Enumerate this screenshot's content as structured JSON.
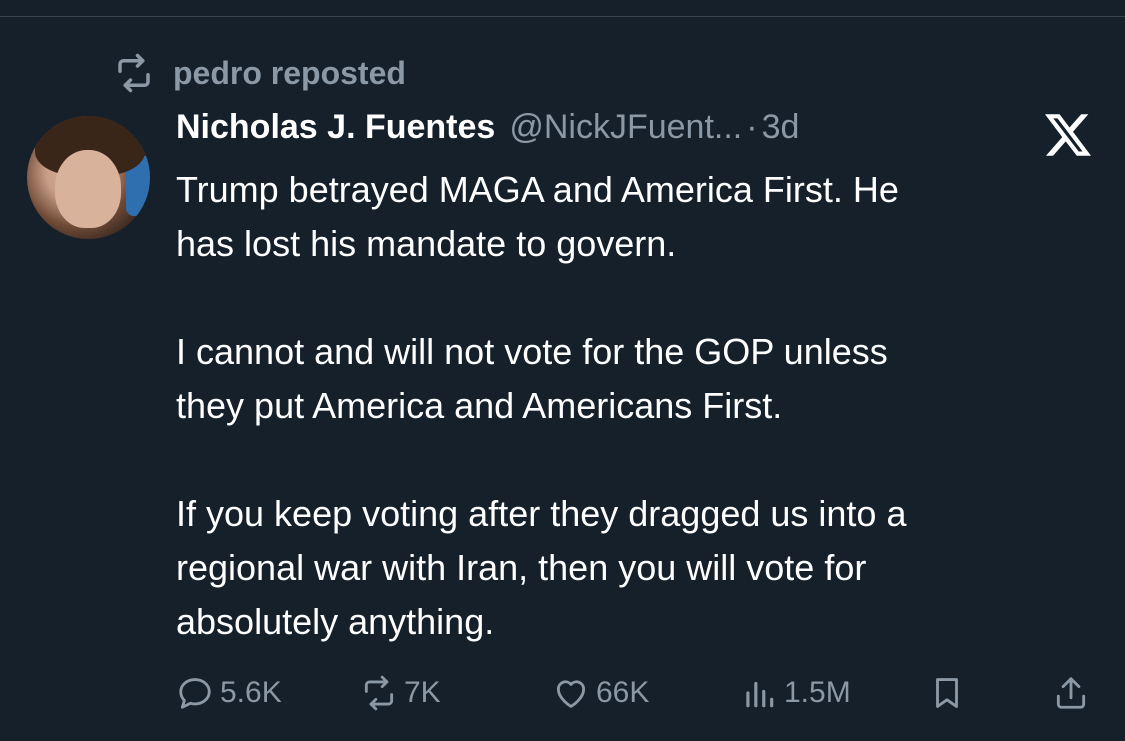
{
  "repost": {
    "icon": "repost-icon",
    "label": "pedro reposted"
  },
  "author": {
    "avatar": "avatar",
    "name": "Nicholas J. Fuentes",
    "handle": "@NickJFuent...",
    "separator": "·",
    "time": "3d"
  },
  "logo": "x-logo-icon",
  "tweet": {
    "text": "Trump betrayed MAGA and America First. He\nhas lost his mandate to govern.\n\nI cannot and will not vote for the GOP unless\nthey put America and Americans First.\n\nIf you keep voting after they dragged us into a\nregional war with Iran, then you will vote for\nabsolutely anything."
  },
  "actions": {
    "reply": {
      "icon": "reply-icon",
      "count": "5.6K"
    },
    "repost": {
      "icon": "repost-icon",
      "count": "7K"
    },
    "like": {
      "icon": "heart-icon",
      "count": "66K"
    },
    "views": {
      "icon": "views-icon",
      "count": "1.5M"
    },
    "bookmark": {
      "icon": "bookmark-icon"
    },
    "share": {
      "icon": "share-icon"
    }
  },
  "colors": {
    "background": "#15202b",
    "text": "#ffffff",
    "secondary_text": "#8b98a5"
  }
}
